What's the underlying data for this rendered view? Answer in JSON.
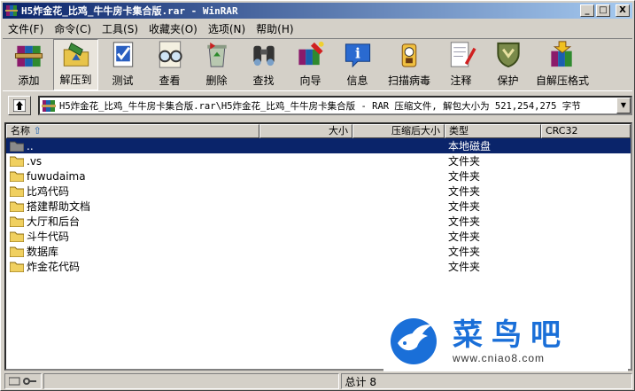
{
  "window": {
    "title": "H5炸金花_比鸡_牛牛房卡集合版.rar - WinRAR"
  },
  "window_buttons": {
    "minimize": "_",
    "maximize": "□",
    "close": "X"
  },
  "menu": [
    "文件(F)",
    "命令(C)",
    "工具(S)",
    "收藏夹(O)",
    "选项(N)",
    "帮助(H)"
  ],
  "toolbar": [
    {
      "label": "添加",
      "icon": "add-books-icon"
    },
    {
      "label": "解压到",
      "icon": "extract-folder-icon"
    },
    {
      "label": "测试",
      "icon": "test-check-icon"
    },
    {
      "label": "查看",
      "icon": "view-glasses-icon"
    },
    {
      "label": "删除",
      "icon": "delete-recycle-icon"
    },
    {
      "label": "查找",
      "icon": "find-binoculars-icon"
    },
    {
      "label": "向导",
      "icon": "wizard-icon"
    },
    {
      "label": "信息",
      "icon": "info-icon"
    },
    {
      "label": "扫描病毒",
      "icon": "virus-scan-icon"
    },
    {
      "label": "注释",
      "icon": "comment-pen-icon"
    },
    {
      "label": "保护",
      "icon": "protect-shield-icon"
    },
    {
      "label": "自解压格式",
      "icon": "sfx-icon"
    }
  ],
  "address": {
    "text": "H5炸金花_比鸡_牛牛房卡集合版.rar\\H5炸金花_比鸡_牛牛房卡集合版 - RAR 压缩文件, 解包大小为 521,254,275 字节"
  },
  "columns": {
    "name": "名称",
    "size": "大小",
    "packed": "压缩后大小",
    "type": "类型",
    "crc": "CRC32"
  },
  "files": [
    {
      "name": "..",
      "type": "本地磁盘",
      "selected": true
    },
    {
      "name": ".vs",
      "type": "文件夹"
    },
    {
      "name": "fuwudaima",
      "type": "文件夹"
    },
    {
      "name": "比鸡代码",
      "type": "文件夹"
    },
    {
      "name": "搭建帮助文档",
      "type": "文件夹"
    },
    {
      "name": "大厅和后台",
      "type": "文件夹"
    },
    {
      "name": "斗牛代码",
      "type": "文件夹"
    },
    {
      "name": "数据库",
      "type": "文件夹"
    },
    {
      "name": "炸金花代码",
      "type": "文件夹"
    }
  ],
  "status": {
    "total": "总计 8"
  },
  "watermark": {
    "name": "菜鸟吧",
    "url": "www.cniao8.com"
  },
  "colors": {
    "title_start": "#0a246a",
    "title_end": "#a6caf0",
    "selection": "#0a246a",
    "watermark": "#1a6fd8"
  }
}
